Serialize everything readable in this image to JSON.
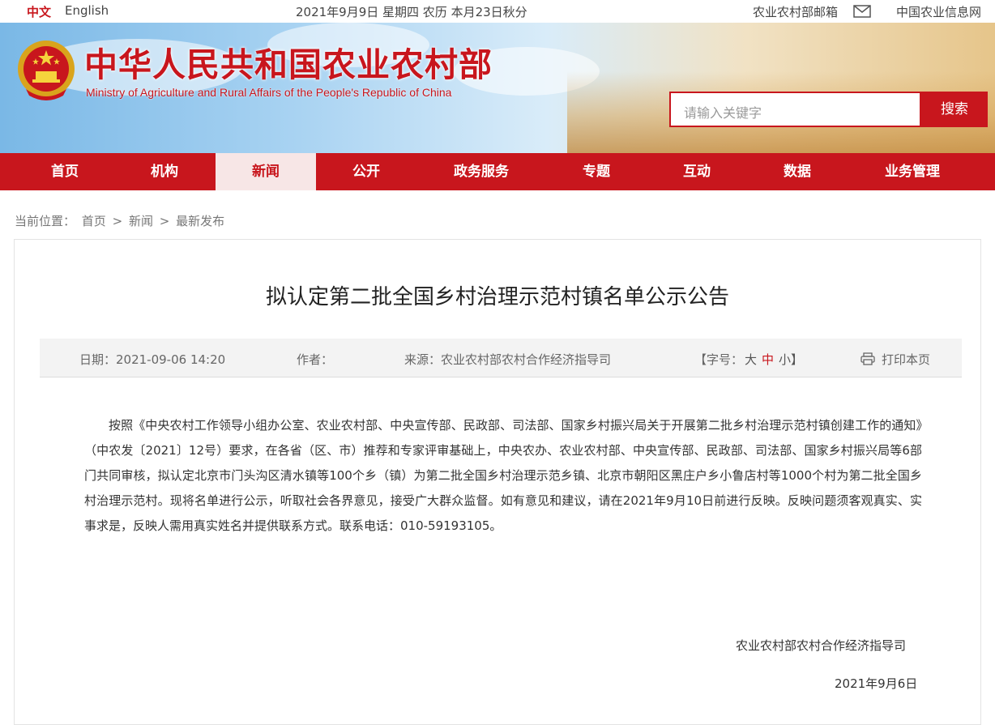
{
  "topbar": {
    "lang_zh": "中文",
    "lang_en": "English",
    "date": "2021年9月9日 星期四 农历 本月23日秋分",
    "mail_label": "农业农村部邮箱",
    "info_site": "中国农业信息网"
  },
  "header": {
    "title": "中华人民共和国农业农村部",
    "subtitle": "Ministry of Agriculture and Rural Affairs of the People's Republic of China",
    "search": {
      "placeholder": "请输入关键字",
      "button": "搜索"
    }
  },
  "nav": {
    "items": [
      {
        "label": "首页"
      },
      {
        "label": "机构"
      },
      {
        "label": "新闻",
        "active": true
      },
      {
        "label": "公开"
      },
      {
        "label": "政务服务"
      },
      {
        "label": "专题"
      },
      {
        "label": "互动"
      },
      {
        "label": "数据"
      },
      {
        "label": "业务管理"
      }
    ]
  },
  "breadcrumb": {
    "prefix": "当前位置：",
    "items": [
      "首页",
      ">",
      "新闻",
      ">",
      "最新发布"
    ]
  },
  "article": {
    "title": "拟认定第二批全国乡村治理示范村镇名单公示公告",
    "meta": {
      "date": "日期：2021-09-06 14:20",
      "author": "作者：",
      "source": "来源：农业农村部农村合作经济指导司",
      "font_size_label": "【字号：",
      "font_large": "大",
      "font_mid": "中",
      "font_small": "小】",
      "print": "打印本页"
    },
    "body": "按照《中央农村工作领导小组办公室、农业农村部、中央宣传部、民政部、司法部、国家乡村振兴局关于开展第二批乡村治理示范村镇创建工作的通知》（中农发〔2021〕12号）要求，在各省（区、市）推荐和专家评审基础上，中央农办、农业农村部、中央宣传部、民政部、司法部、国家乡村振兴局等6部门共同审核，拟认定北京市门头沟区清水镇等100个乡（镇）为第二批全国乡村治理示范乡镇、北京市朝阳区黑庄户乡小鲁店村等1000个村为第二批全国乡村治理示范村。现将名单进行公示，听取社会各界意见，接受广大群众监督。如有意见和建议，请在2021年9月10日前进行反映。反映问题须客观真实、实事求是，反映人需用真实姓名并提供联系方式。联系电话：010-59193105。",
    "signature_org": "农业农村部农村合作经济指导司",
    "signature_date": "2021年9月6日"
  },
  "colors": {
    "brand_red": "#c8161d",
    "nav_active_bg": "#f7e6e6"
  },
  "icons": {
    "mail": "envelope-icon",
    "print": "printer-icon",
    "emblem": "national-emblem"
  }
}
